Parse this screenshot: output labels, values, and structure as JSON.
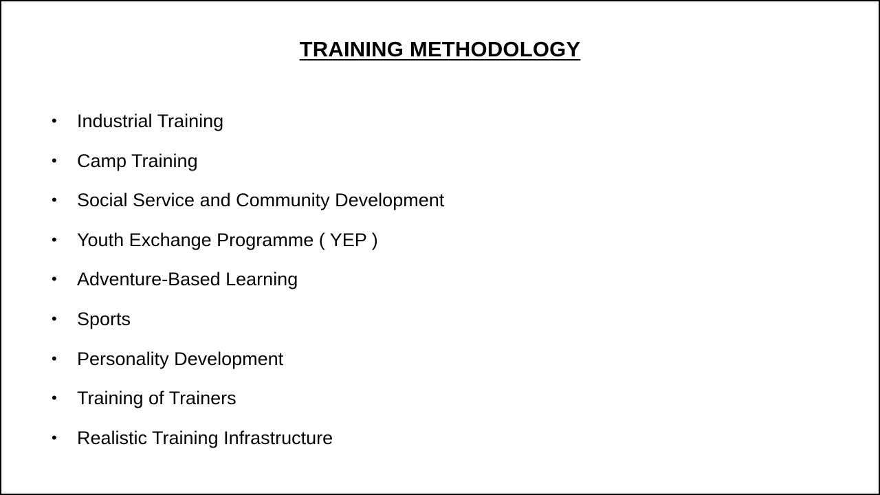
{
  "slide": {
    "title": "TRAINING  METHODOLOGY",
    "items": [
      "Industrial Training",
      "Camp Training",
      "Social Service and Community Development",
      "Youth Exchange Programme ( YEP )",
      "Adventure-Based Learning",
      "Sports",
      "Personality Development",
      "Training of Trainers",
      "Realistic Training Infrastructure"
    ]
  },
  "icons": {
    "bullet": "bullet-dot-icon"
  },
  "colors": {
    "background": "#ffffff",
    "text": "#000000",
    "border": "#000000"
  }
}
